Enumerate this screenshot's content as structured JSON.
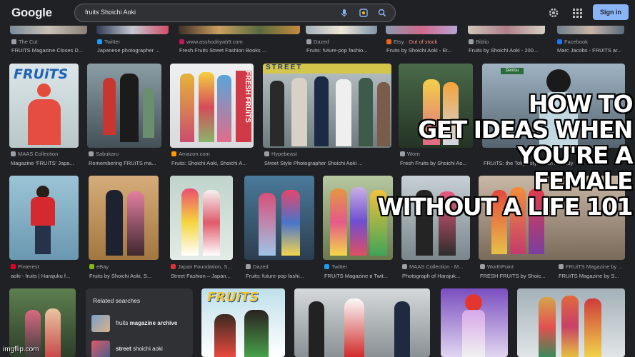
{
  "header": {
    "logo": "Google",
    "search_query": "fruits Shoichi Aoki",
    "signin_label": "Sign in"
  },
  "top_row": [
    {
      "source": "The Cut",
      "title": "FRUiTS Magazine Closes D..."
    },
    {
      "source": "Twitter",
      "title": "Japanese photographer ..."
    },
    {
      "source": "www.asshodriyah9.com",
      "title": "Fresh Fruits Street Fashion Books ..."
    },
    {
      "source": "Dazed",
      "title": "Fruits: future-pop fashio..."
    },
    {
      "source": "Etsy",
      "stock": "Out of stock",
      "title": "Fruits by Shoichi Aoki - Et..."
    },
    {
      "source": "Biblio",
      "title": "Fruits by Shoichi Aoki - 200..."
    },
    {
      "source": "Facebook",
      "title": "Marc Jacobs - FRUiTS ar..."
    }
  ],
  "row2": [
    {
      "source": "MAAS Collection",
      "title": "Magazine 'FRUiTS' Japa...",
      "cover": "FRUiTS"
    },
    {
      "source": "Sabukaru",
      "title": "Remembering FRUiTS ma..."
    },
    {
      "source": "Amazon.com",
      "title": "Fruits: Shoichi Aoki, Shoichi A...",
      "cover": "FRESH FRUiTS"
    },
    {
      "source": "Hypebeast",
      "title": "Street Style Photographer Shoichi Aoki ...",
      "cover": "STREET"
    },
    {
      "source": "Worn",
      "title": "Fresh Fruits by Shoichi Ao..."
    },
    {
      "source": "",
      "title": "FRUiTS: the Tokyo style man is ready"
    }
  ],
  "row3": [
    {
      "source": "Pinterest",
      "title": "aoki - fruits | Harajuku f..."
    },
    {
      "source": "eBay",
      "title": "Fruits by Shoichi Aoki, S..."
    },
    {
      "source": "Japan Foundation, S...",
      "title": "Street Fashion – Japan..."
    },
    {
      "source": "Dazed",
      "title": "Fruits: future-pop fashi..."
    },
    {
      "source": "Twitter",
      "title": "FRUiTS Magazine в Twit..."
    },
    {
      "source": "MAAS Collection - M...",
      "title": "Photograph of Harajuk..."
    },
    {
      "source": "WorthPoint",
      "title": "FRESH FRUITS by Shoic..."
    },
    {
      "source": "FRUiTS Magazine by ...",
      "title": "FRUiTS Magazine by S..."
    }
  ],
  "row4": [
    {
      "cover": "FRUiTS"
    }
  ],
  "related": {
    "title": "Related searches",
    "items": [
      {
        "prefix": "fruits ",
        "bold": "magazine archive"
      },
      {
        "prefix": "",
        "bold": "street",
        "suffix": " shoichi aoki"
      }
    ]
  },
  "caption": "HOW TO GET IDEAS WHEN YOU'RE A FEMALE WITHOUT A LIFE 101",
  "caption_lines": [
    "HOW TO",
    "GET IDEAS WHEN",
    "YOU'RE A",
    "FEMALE",
    "WITHOUT A LIFE 101"
  ],
  "watermark": "imgflip.com",
  "colors": {
    "background": "#202124",
    "link": "#8ab4f8",
    "stock": "#f28b82"
  }
}
